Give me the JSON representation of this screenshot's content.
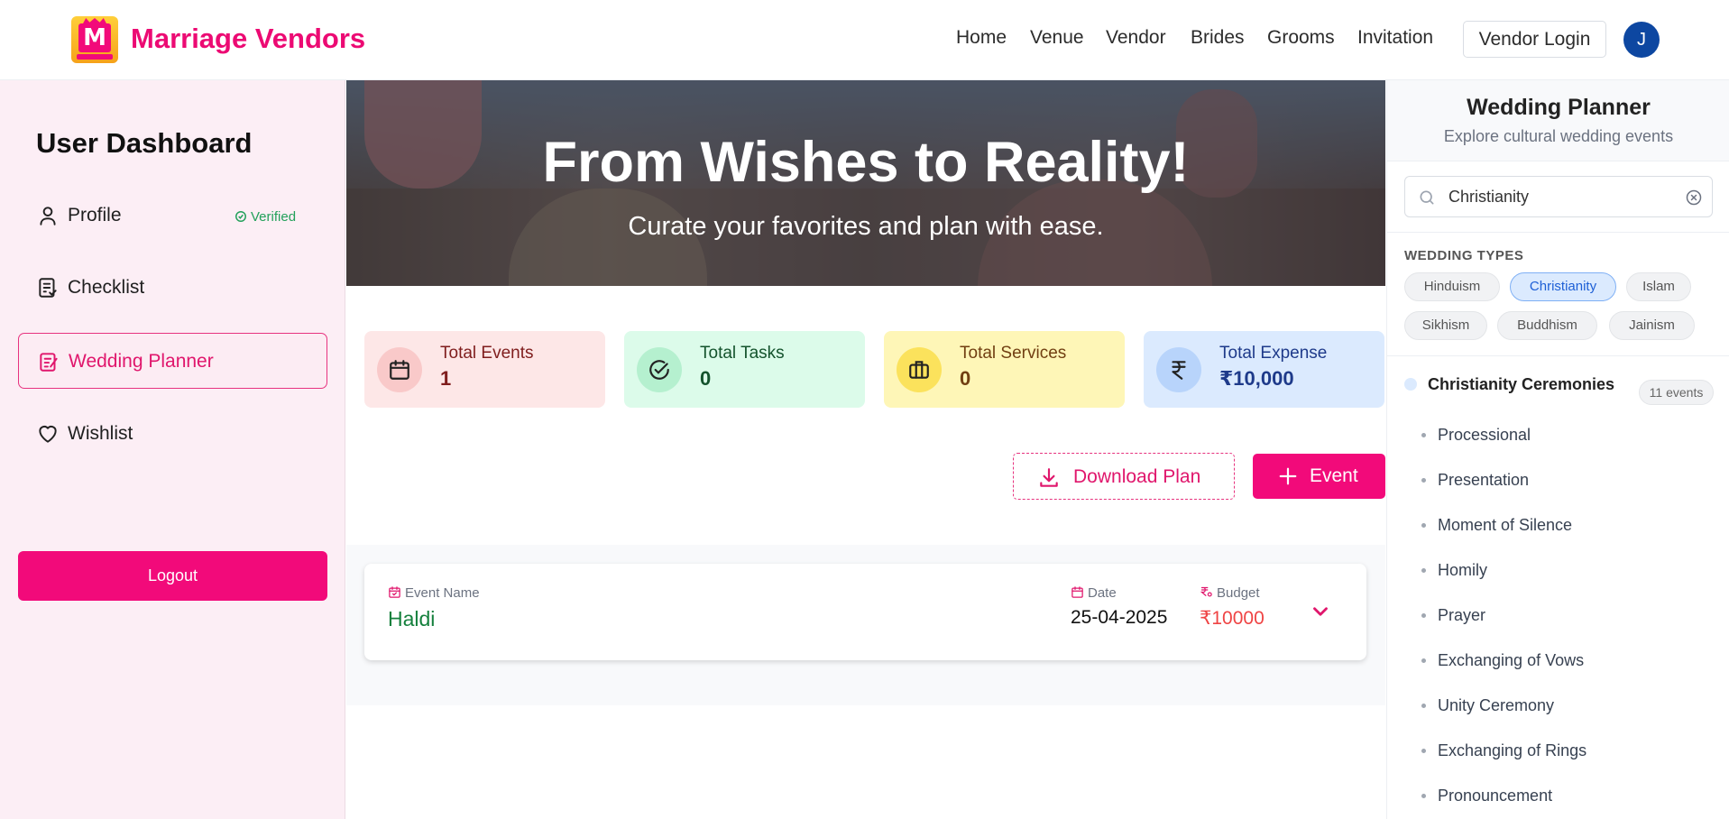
{
  "header": {
    "brand": "Marriage Vendors",
    "logo_letter": "M",
    "nav": [
      "Home",
      "Venue",
      "Vendor",
      "Brides",
      "Grooms",
      "Invitation"
    ],
    "vendor_login": "Vendor Login",
    "avatar_initial": "J"
  },
  "sidebar": {
    "title": "User Dashboard",
    "items": [
      {
        "label": "Profile",
        "icon": "user-icon"
      },
      {
        "label": "Checklist",
        "icon": "checklist-icon"
      },
      {
        "label": "Wedding Planner",
        "icon": "planner-icon",
        "active": true
      },
      {
        "label": "Wishlist",
        "icon": "heart-icon"
      }
    ],
    "verified_badge": "Verified",
    "logout": "Logout"
  },
  "banner": {
    "title": "From Wishes to Reality!",
    "subtitle": "Curate your favorites and plan with ease."
  },
  "stats": [
    {
      "label": "Total Events",
      "value": "1",
      "icon": "calendar-icon",
      "bg": "#fde7e7",
      "circle": "#f9c9c9",
      "color": "#7f1d1d"
    },
    {
      "label": "Total Tasks",
      "value": "0",
      "icon": "check-circle-icon",
      "bg": "#dcfbea",
      "circle": "#b5f0cf",
      "color": "#14532d"
    },
    {
      "label": "Total Services",
      "value": "0",
      "icon": "briefcase-icon",
      "bg": "#fef6b7",
      "circle": "#fbe25c",
      "color": "#713f12"
    },
    {
      "label": "Total Expense",
      "value": "₹10,000",
      "icon": "rupee-icon",
      "bg": "#dbeafe",
      "circle": "#b8d4fb",
      "color": "#1e3a8a"
    }
  ],
  "actions": {
    "download": "Download Plan",
    "add_event": "Event"
  },
  "event": {
    "name_label": "Event Name",
    "name": "Haldi",
    "date_label": "Date",
    "date": "25-04-2025",
    "budget_label": "Budget",
    "budget": "₹10000"
  },
  "planner": {
    "title": "Wedding Planner",
    "subtitle": "Explore cultural wedding events",
    "search_value": "Christianity",
    "types_label": "WEDDING TYPES",
    "types": [
      "Hinduism",
      "Christianity",
      "Islam",
      "Sikhism",
      "Buddhism",
      "Jainism"
    ],
    "selected_type": "Christianity",
    "ceremonies_title": "Christianity Ceremonies",
    "ceremonies_count": "11 events",
    "ceremonies": [
      "Processional",
      "Presentation",
      "Moment of Silence",
      "Homily",
      "Prayer",
      "Exchanging of Vows",
      "Unity Ceremony",
      "Exchanging of Rings",
      "Pronouncement"
    ]
  },
  "colors": {
    "brand": "#ec0a73",
    "accent": "#f20a7a",
    "sidebar_bg": "#fceef5"
  }
}
